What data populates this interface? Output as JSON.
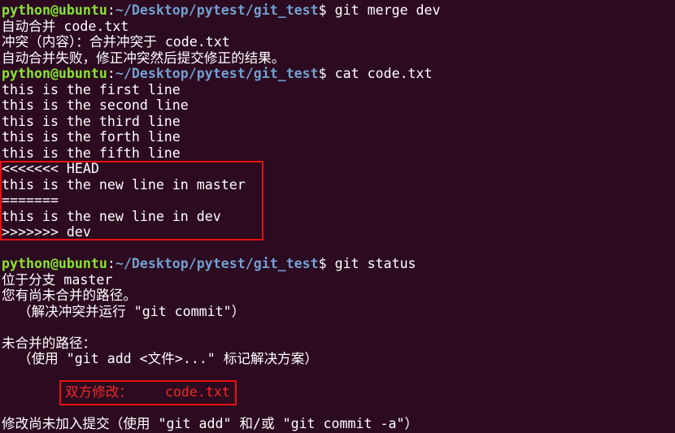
{
  "colors": {
    "background": "#2c0a1f",
    "user_host": "#8ae234",
    "path": "#729fcf",
    "text": "#ffffff",
    "conflict_text": "#ef2929",
    "highlight_border": "#e81010"
  },
  "prompt": {
    "user_host": "python@ubuntu",
    "path": "~/Desktop/pytest/git_test",
    "symbol": "$"
  },
  "commands": {
    "merge": "git merge dev",
    "cat": "cat code.txt",
    "status": "git status"
  },
  "merge_output": [
    "自动合并 code.txt",
    "冲突（内容）：合并冲突于 code.txt",
    "自动合并失败，修正冲突然后提交修正的结果。"
  ],
  "file_lines": [
    "this is the first line",
    "this is the second line",
    "this is the third line",
    "this is the forth line",
    "this is the fifth line"
  ],
  "conflict_lines": [
    "<<<<<<< HEAD",
    "this is the new line in master",
    "=======",
    "this is the new line in dev",
    ">>>>>>> dev"
  ],
  "status_output": {
    "branch": "位于分支 master",
    "unmerged_paths": "您有尚未合并的路径。",
    "hint_resolve": "  （解决冲突并运行 \"git commit\"）",
    "unmerged_header": "未合并的路径：",
    "hint_add": "  （使用 \"git add <文件>...\" 标记解决方案）",
    "both_modified_label": "双方修改：",
    "both_modified_file": "code.txt",
    "no_changes": "修改尚未加入提交（使用 \"git add\" 和/或 \"git commit -a\"）"
  }
}
